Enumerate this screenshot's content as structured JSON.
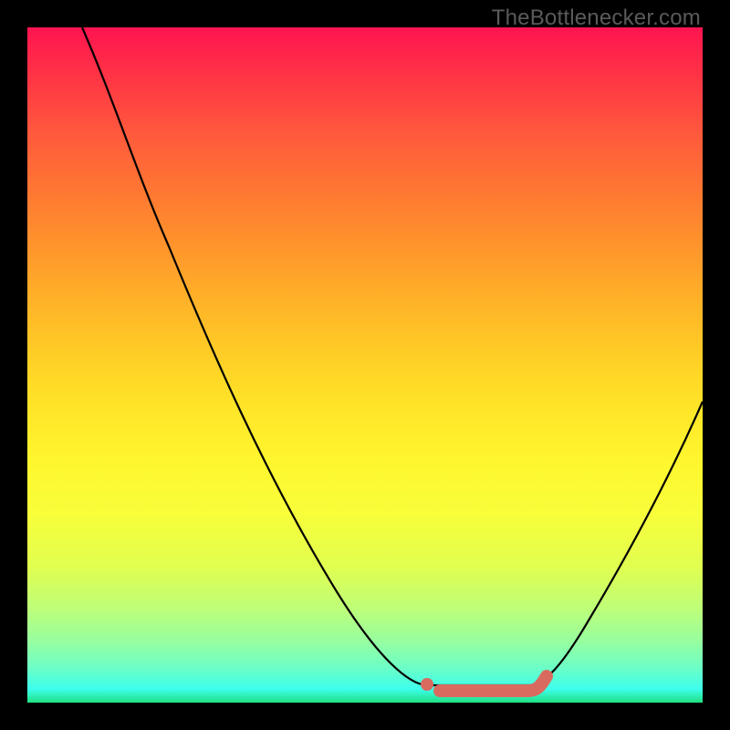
{
  "watermark": "TheBottlenecker.com",
  "chart_data": {
    "type": "line",
    "title": "",
    "xlabel": "",
    "ylabel": "",
    "xlim": [
      0,
      100
    ],
    "ylim": [
      0,
      100
    ],
    "background_gradient": {
      "top_color": "#ff1450",
      "bottom_color": "#20e080",
      "meaning": "red_high_bottleneck_green_low_bottleneck"
    },
    "series": [
      {
        "name": "bottleneck_curve",
        "x": [
          8,
          12,
          17,
          21,
          27,
          34,
          41,
          46,
          52,
          56,
          59,
          61,
          74,
          77,
          80,
          83,
          88,
          93,
          100
        ],
        "y": [
          100,
          92,
          82,
          72,
          58,
          42,
          26,
          15,
          6,
          3,
          2.5,
          2.5,
          2.5,
          3,
          6,
          12,
          22,
          33,
          45
        ],
        "stroke": "#000000"
      }
    ],
    "optimal_range_marker": {
      "color": "#d96a5f",
      "x_start": 59,
      "x_end": 77,
      "y": 2
    },
    "grid": false,
    "legend": false
  }
}
